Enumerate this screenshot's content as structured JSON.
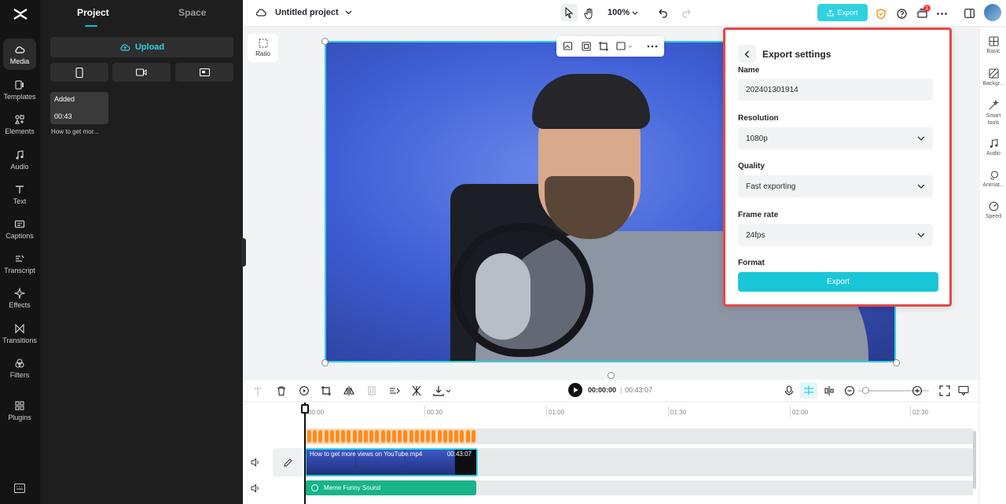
{
  "rail": {
    "items": [
      {
        "label": "Media"
      },
      {
        "label": "Templates"
      },
      {
        "label": "Elements"
      },
      {
        "label": "Audio"
      },
      {
        "label": "Text"
      },
      {
        "label": "Captions"
      },
      {
        "label": "Transcript"
      },
      {
        "label": "Effects"
      },
      {
        "label": "Transitions"
      },
      {
        "label": "Filters"
      },
      {
        "label": "Plugins"
      }
    ]
  },
  "panel": {
    "tab_project": "Project",
    "tab_space": "Space",
    "upload_label": "Upload",
    "media": {
      "badge": "Added",
      "duration": "00:43",
      "name": "How to get mor..."
    }
  },
  "topbar": {
    "project_title": "Untitled project",
    "zoom": "100%",
    "export_label": "Export",
    "notification_count": "1"
  },
  "canvas": {
    "ratio_label": "Ratio"
  },
  "export_settings": {
    "title": "Export settings",
    "name_label": "Name",
    "name_value": "202401301914",
    "resolution_label": "Resolution",
    "resolution_value": "1080p",
    "quality_label": "Quality",
    "quality_value": "Fast exporting",
    "framerate_label": "Frame rate",
    "framerate_value": "24fps",
    "format_label": "Format",
    "export_button": "Export"
  },
  "props": {
    "items": [
      {
        "label": "Basic"
      },
      {
        "label": "Backgr..."
      },
      {
        "label": "Smart tools"
      },
      {
        "label": "Audio"
      },
      {
        "label": "Animat..."
      },
      {
        "label": "Speed"
      }
    ]
  },
  "timeline": {
    "current_time": "00:00:00",
    "separator": "|",
    "total_time": "00:43:07",
    "ruler": [
      "00:00",
      "00:30",
      "01:00",
      "01:30",
      "02:00",
      "02:30"
    ],
    "video_clip_label": "How to get more views on YouTube.mp4",
    "video_clip_duration": "00:43:07",
    "audio_clip_label": "Meme Funny Sound"
  },
  "colors": {
    "accent": "#2fd1e0",
    "highlight_border": "#e54848",
    "audio_orange": "#ff8a1f",
    "audio_green": "#19b38a"
  }
}
